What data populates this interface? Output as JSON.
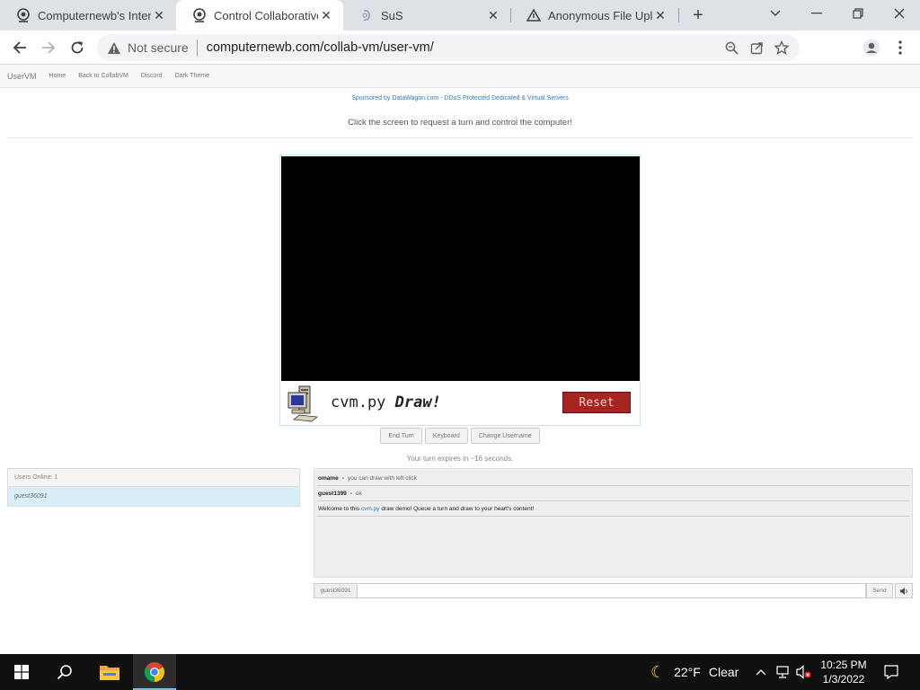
{
  "browser": {
    "tabs": [
      {
        "title": "Computernewb's Intern",
        "icon": "vm-logo-icon",
        "active": false
      },
      {
        "title": "Control Collaborative V",
        "icon": "vm-logo-icon",
        "active": true
      },
      {
        "title": "SuS",
        "icon": "loading-icon",
        "active": false
      },
      {
        "title": "Anonymous File Upload",
        "icon": "file-upload-icon",
        "active": false
      }
    ],
    "new_tab_label": "+",
    "security_label": "Not secure",
    "url": "computernewb.com/collab-vm/user-vm/"
  },
  "site": {
    "brand": "UserVM",
    "nav_links": [
      "Home",
      "Back to CollabVM",
      "Discord",
      "Dark Theme"
    ],
    "sponsor": "Sponsored by DataWagon.com - DDoS Protected Dedicated & Virtual Servers",
    "instruction": "Click the screen to request a turn and control the computer!"
  },
  "vm": {
    "app_name": "cvm.py",
    "app_action": "Draw!",
    "reset_label": "Reset",
    "buttons": [
      "End Turn",
      "Keyboard",
      "Change Username"
    ],
    "turn_message": "Your turn expires in ~16 seconds."
  },
  "users": {
    "header": "Users Online: 1",
    "list": [
      "guest36091"
    ]
  },
  "chat": {
    "messages": [
      {
        "user": "omame",
        "text": "you can draw with left click"
      },
      {
        "user": "guest1399",
        "text": "ok"
      }
    ],
    "system_prefix": "Welcome to this",
    "system_link": "cvm.py",
    "system_suffix": "draw demo! Queue a turn and draw to your heart's content!",
    "username": "guest36091",
    "send_label": "Send"
  },
  "taskbar": {
    "weather_temp": "22°F",
    "weather_condition": "Clear",
    "time": "10:25 PM",
    "date": "1/3/2022"
  },
  "colors": {
    "reset_button": "#a52421",
    "user_row": "#d9eff7",
    "link": "#337ab7",
    "taskbar": "#101010"
  }
}
